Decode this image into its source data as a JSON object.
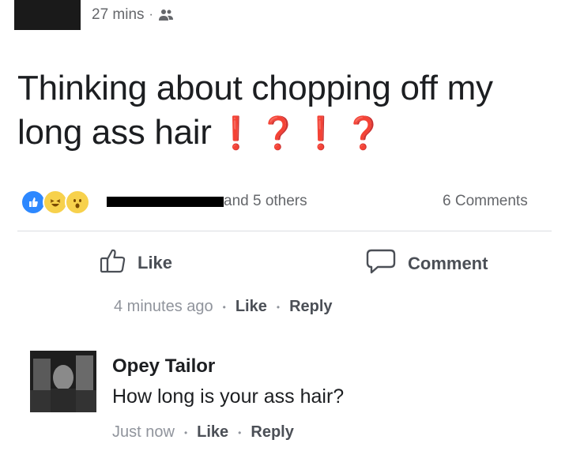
{
  "post": {
    "timestamp": "27 mins",
    "separator": "·",
    "audience_icon": "friends-icon",
    "text_line1": "Thinking about chopping off my",
    "text_line2": "long ass hair",
    "punctuation": "❗❓❗❓"
  },
  "reactions": {
    "icons": [
      "like-reaction-icon",
      "haha-reaction-icon",
      "wow-reaction-icon"
    ],
    "others_text": "and 5 others",
    "comments_count": "6 Comments"
  },
  "actions": {
    "like": "Like",
    "comment": "Comment"
  },
  "comment_meta": {
    "time": "4 minutes ago",
    "like": "Like",
    "reply": "Reply",
    "dot": "•"
  },
  "reply": {
    "name": "Opey Tailor",
    "text": "How long is your ass hair?",
    "time": "Just now",
    "like": "Like",
    "reply": "Reply",
    "dot": "•"
  }
}
